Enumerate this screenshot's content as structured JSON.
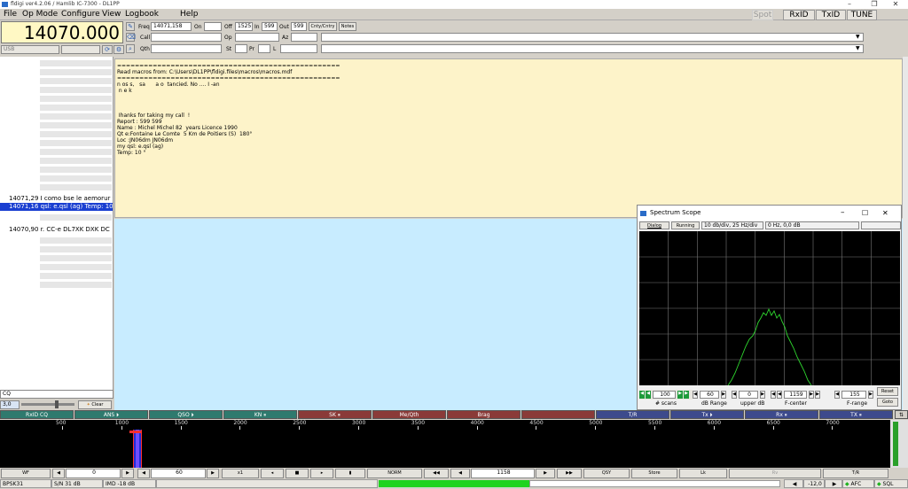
{
  "window": {
    "title": "fldigi ver4.2.06 / Hamlib IC-7300 - DL1PP"
  },
  "menu": {
    "file": "File",
    "op_mode": "Op Mode",
    "configure": "Configure",
    "view": "View",
    "logbook": "Logbook",
    "help": "Help"
  },
  "top_buttons": {
    "spot": "Spot",
    "rxid": "RxID",
    "txid": "TxID",
    "tune": "TUNE"
  },
  "freq_display": "14070.000",
  "mode_select": "USB",
  "qso": {
    "freq_label": "Freq",
    "freq_value": "14071,158",
    "on_label": "On",
    "off_label": "Off",
    "off_value": "1525",
    "in_label": "In",
    "in_value": "599",
    "out_label": "Out",
    "out_value": "599",
    "cnty_btn": "Cnty/Cntry",
    "notes_btn": "Notes",
    "call_label": "Call",
    "op_label": "Op",
    "az_label": "Az",
    "qth_label": "Qth",
    "st_label": "St",
    "pr_label": "Pr",
    "l_label": "L"
  },
  "browser": {
    "entries": [
      {
        "freq": "14071,29",
        "text": "I como bse le  aemorur y"
      },
      {
        "freq": "14071,16",
        "text": "qsl: e.qsl (ag) Temp: 10"
      },
      {
        "freq": "14070,90",
        "text": "r. CC-e DL7XK DXK DC"
      }
    ],
    "search_value": "CQ",
    "squelch_value": "3,0",
    "clear_btn": "Clear"
  },
  "rx_text": "==================================================\nRead macros from: C:\\Users\\DL1PP\\fldigi.files\\macros\\macros.mdf\n==================================================\nn os s,   sa      a o  tancied. No .... I -an\n n e k\n\n\n\n Ihanks for taking my call  !\nReport : 599 599\nName : Michel Michel 82  years Licence 1990\nQt e:Fontaine Le Comte  5 Km de Poitiers (S)  180°\nLoc :JN06dm JN06dm\nmy qsl: e.qsl (ag)\nTemp: 10 °",
  "scope": {
    "title": "Spectrum Scope",
    "dialog_btn": "Dialog",
    "running_btn": "Running",
    "scale_info": "10 db/div, 25 Hz/div",
    "peak_info": "0 Hz, 0,0 dB",
    "scans_value": "100",
    "scans_label": "# scans",
    "range_value": "60",
    "range_label": "dB Range",
    "upper_value": "0",
    "upper_label": "upper dB",
    "center_value": "1159",
    "center_label": "F-center",
    "frange_value": "155",
    "frange_label": "F-range",
    "reset_btn": "Reset",
    "goto_btn": "Goto"
  },
  "macros": [
    {
      "label": "RxID CQ",
      "color": "#2f7a6e"
    },
    {
      "label": "ANS ⏵",
      "color": "#2f7a6e"
    },
    {
      "label": "QSO ⏵",
      "color": "#2f7a6e"
    },
    {
      "label": "KN ⏸",
      "color": "#2f7a6e"
    },
    {
      "label": "SK ⏸",
      "color": "#8a3a38"
    },
    {
      "label": "Me/Qth",
      "color": "#8a3a38"
    },
    {
      "label": "Brag",
      "color": "#8a3a38"
    },
    {
      "label": "",
      "color": "#8a3a38"
    },
    {
      "label": "T/R",
      "color": "#3d4a8c"
    },
    {
      "label": "Tx ⏵",
      "color": "#3d4a8c"
    },
    {
      "label": "Rx ⏸",
      "color": "#3d4a8c"
    },
    {
      "label": "TX ⏸",
      "color": "#3d4a8c"
    }
  ],
  "waterfall": {
    "ticks": [
      "500",
      "1000",
      "1500",
      "2000",
      "2500",
      "3000",
      "3500",
      "4000",
      "4500",
      "5000",
      "5500",
      "6000",
      "6500",
      "7000"
    ]
  },
  "bottom": {
    "wf_btn": "WF",
    "offset_value": "0",
    "rate_value": "60",
    "x1_btn": "x1",
    "norm_btn": "NORM",
    "carrier_value": "1158",
    "qsy_btn": "QSY",
    "store_btn": "Store",
    "lk_btn": "Lk",
    "rv_btn": "Rv",
    "tr_btn": "T/R"
  },
  "status": {
    "mode": "BPSK31",
    "sn": "S/N 31 dB",
    "imd": "IMD -18 dB",
    "afc_value": "-12,0",
    "afc_label": "AFC",
    "sql_label": "SQL"
  }
}
